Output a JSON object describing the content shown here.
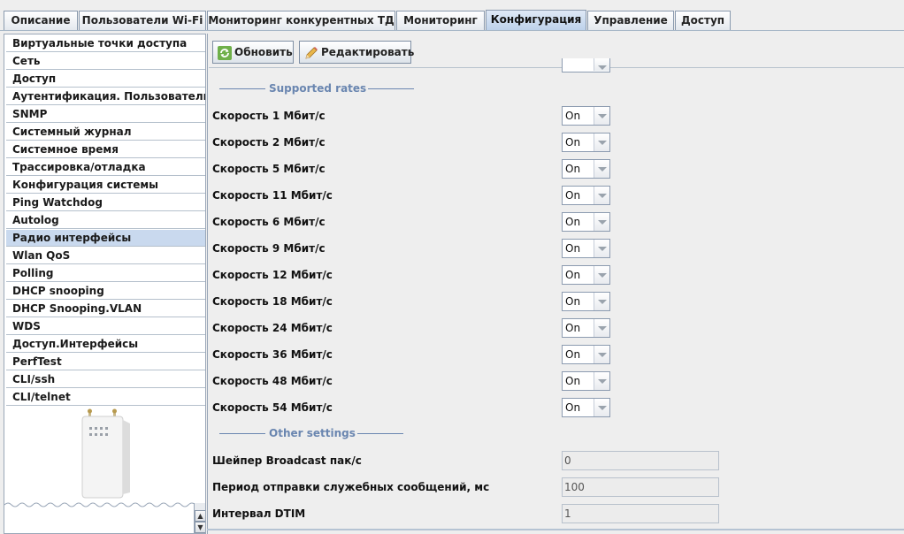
{
  "tabs": [
    {
      "label": "Описание",
      "active": false
    },
    {
      "label": "Пользователи Wi-Fi",
      "active": false
    },
    {
      "label": "Мониторинг конкурентных ТД",
      "active": false
    },
    {
      "label": "Мониторинг",
      "active": false
    },
    {
      "label": "Конфигурация",
      "active": true
    },
    {
      "label": "Управление",
      "active": false
    },
    {
      "label": "Доступ",
      "active": false
    }
  ],
  "sidebar": {
    "items": [
      {
        "label": "Виртуальные точки доступа"
      },
      {
        "label": "Сеть"
      },
      {
        "label": "Доступ"
      },
      {
        "label": "Аутентификация. Пользователи"
      },
      {
        "label": "SNMP"
      },
      {
        "label": "Системный журнал"
      },
      {
        "label": "Системное время"
      },
      {
        "label": "Трассировка/отладка"
      },
      {
        "label": "Конфигурация системы"
      },
      {
        "label": "Ping Watchdog"
      },
      {
        "label": "Autolog"
      },
      {
        "label": "Радио интерфейсы",
        "selected": true
      },
      {
        "label": "Wlan QoS"
      },
      {
        "label": "Polling"
      },
      {
        "label": "DHCP snooping"
      },
      {
        "label": "DHCP Snooping.VLAN"
      },
      {
        "label": "WDS"
      },
      {
        "label": "Доступ.Интерфейсы"
      },
      {
        "label": "PerfTest"
      },
      {
        "label": "CLI/ssh"
      },
      {
        "label": "CLI/telnet"
      }
    ]
  },
  "toolbar": {
    "refresh_label": "Обновить",
    "edit_label": "Редактировать"
  },
  "supported_rates": {
    "title": "Supported rates",
    "rows": [
      {
        "label": "Скорость 1 Мбит/с",
        "value": "On"
      },
      {
        "label": "Скорость 2 Мбит/с",
        "value": "On"
      },
      {
        "label": "Скорость 5 Мбит/с",
        "value": "On"
      },
      {
        "label": "Скорость 11 Мбит/с",
        "value": "On"
      },
      {
        "label": "Скорость 6 Мбит/с",
        "value": "On"
      },
      {
        "label": "Скорость 9 Мбит/с",
        "value": "On"
      },
      {
        "label": "Скорость 12 Мбит/с",
        "value": "On"
      },
      {
        "label": "Скорость 18 Мбит/с",
        "value": "On"
      },
      {
        "label": "Скорость 24 Мбит/с",
        "value": "On"
      },
      {
        "label": "Скорость 36 Мбит/с",
        "value": "On"
      },
      {
        "label": "Скорость 48 Мбит/с",
        "value": "On"
      },
      {
        "label": "Скорость 54 Мбит/с",
        "value": "On"
      }
    ]
  },
  "other_settings": {
    "title": "Other settings",
    "rows": [
      {
        "label": "Шейпер Broadcast пак/с",
        "value": "0"
      },
      {
        "label": "Период отправки служебных сообщений, мс",
        "value": "100"
      },
      {
        "label": "Интервал DTIM",
        "value": "1"
      }
    ]
  },
  "colors": {
    "accent": "#6a86b0",
    "selected_bg": "#c9d9ee",
    "active_tab": "#bcd0ea"
  }
}
